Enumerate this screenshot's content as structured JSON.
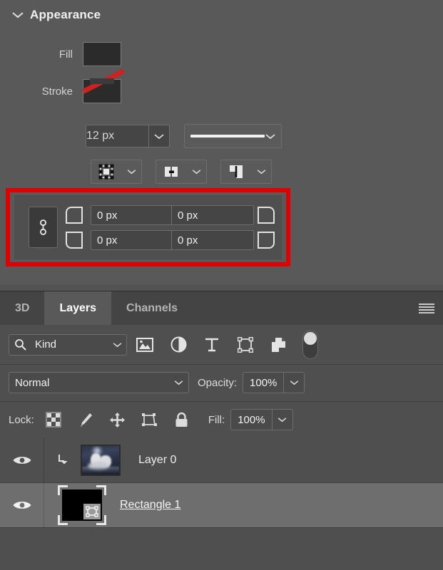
{
  "appearance": {
    "title": "Appearance",
    "twisty_icon": "chevron-down-icon",
    "fill": {
      "label": "Fill",
      "swatch_color": "#000000"
    },
    "stroke": {
      "label": "Stroke",
      "swatch_type": "no-stroke-swatch",
      "slash_color": "#cc2222",
      "width_value": "12 px",
      "line_style": "solid-line"
    },
    "stroke_options": [
      {
        "name": "stroke-align-icon",
        "label": "align"
      },
      {
        "name": "stroke-cap-icon",
        "label": "cap"
      },
      {
        "name": "stroke-corner-icon",
        "label": "corner"
      }
    ],
    "corner_radius": {
      "link_icon": "link-chain-icon",
      "highlight_color": "#e00000",
      "values": [
        {
          "corner": "top-left",
          "value": "0 px"
        },
        {
          "corner": "top-right",
          "value": "0 px"
        },
        {
          "corner": "bottom-left",
          "value": "0 px"
        },
        {
          "corner": "bottom-right",
          "value": "0 px"
        }
      ]
    }
  },
  "layers_panel": {
    "tabs": [
      {
        "label": "3D",
        "active": false
      },
      {
        "label": "Layers",
        "active": true
      },
      {
        "label": "Channels",
        "active": false
      }
    ],
    "menu_icon": "hamburger-menu-icon",
    "filter": {
      "search_icon": "search-icon",
      "kind_label": "Kind",
      "chevron_icon": "chevron-down-icon",
      "type_icons": [
        "pixel-layer-icon",
        "adjustment-layer-icon",
        "type-layer-icon",
        "shape-layer-icon",
        "smart-object-icon"
      ],
      "toggle_icon": "filter-toggle-switch"
    },
    "blend": {
      "mode": "Normal",
      "opacity_label": "Opacity:",
      "opacity_value": "100%"
    },
    "lock": {
      "label": "Lock:",
      "icons": [
        "lock-transparent-pixels-icon",
        "lock-image-pixels-icon",
        "lock-position-icon",
        "lock-artboard-nesting-icon",
        "lock-all-icon"
      ],
      "fill_label": "Fill:",
      "fill_value": "100%"
    },
    "layers": [
      {
        "name": "Layer 0",
        "visible": true,
        "eye_icon": "eye-visibility-icon",
        "clipping_mask_icon": "clipping-mask-arrow-icon",
        "thumbnail": "image-thumbnail",
        "selected": false,
        "editing": false
      },
      {
        "name": "Rectangle 1",
        "visible": true,
        "eye_icon": "eye-visibility-icon",
        "clipping_mask_icon": "",
        "thumbnail": "shape-thumbnail",
        "selected": true,
        "editing": true
      }
    ]
  }
}
